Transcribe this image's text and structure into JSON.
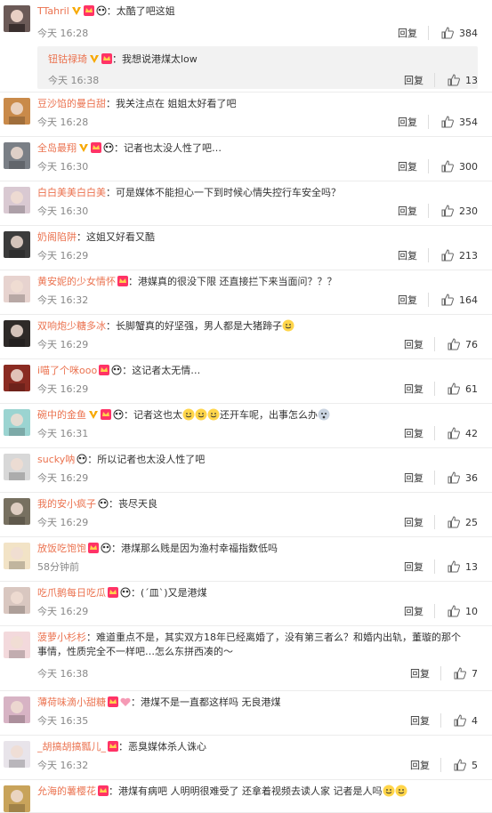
{
  "comments": [
    {
      "user": "TTahril",
      "content": "：太酷了吧这姐",
      "time": "今天 16:28",
      "reply": "回复",
      "likes": "384",
      "sub": {
        "user": "钮钴禄琦",
        "content": "：我想说港煤太low",
        "time": "今天 16:38",
        "reply": "回复",
        "likes": "13"
      }
    },
    {
      "user": "豆沙馅的曼白甜",
      "content": "：我关注点在 姐姐太好看了吧",
      "time": "今天 16:28",
      "reply": "回复",
      "likes": "354"
    },
    {
      "user": "全岛最翔",
      "content": "：记者也太没人性了吧…",
      "time": "今天 16:30",
      "reply": "回复",
      "likes": "300"
    },
    {
      "user": "白白美美白白美",
      "content": "：可是媒体不能担心一下到时候心情失控行车安全吗？",
      "time": "今天 16:30",
      "reply": "回复",
      "likes": "230"
    },
    {
      "user": "奶阁陷阱",
      "content": "：这姐又好看又酷",
      "time": "今天 16:29",
      "reply": "回复",
      "likes": "213"
    },
    {
      "user": "黄安妮的少女情怀",
      "content": "：港媒真的很没下限 还直接拦下来当面问？？？",
      "time": "今天 16:32",
      "reply": "回复",
      "likes": "164"
    },
    {
      "user": "双响炮少糖多冰",
      "content": "：长脚蟹真的好坚强，男人都是大猪蹄子",
      "time": "今天 16:29",
      "reply": "回复",
      "likes": "76"
    },
    {
      "user": "i喵了个咪ooo",
      "content": "：这记者太无情…",
      "time": "今天 16:29",
      "reply": "回复",
      "likes": "61"
    },
    {
      "user": "碗中的金鱼",
      "content": "：记者这也太",
      "content2": "还开车呢，出事怎么办",
      "time": "今天 16:31",
      "reply": "回复",
      "likes": "42"
    },
    {
      "user": "sucky呐",
      "content": "：所以记者也太没人性了吧",
      "time": "今天 16:29",
      "reply": "回复",
      "likes": "36"
    },
    {
      "user": "我的安小疯子",
      "content": "：丧尽天良",
      "time": "今天 16:29",
      "reply": "回复",
      "likes": "25"
    },
    {
      "user": "放饭吃饱饱",
      "content": "：港煤那么贱是因为渔村幸福指数低吗",
      "time": "58分钟前",
      "reply": "回复",
      "likes": "13"
    },
    {
      "user": "吃爪鹅每日吃瓜",
      "content": "：(´皿`)又是港煤",
      "time": "今天 16:29",
      "reply": "回复",
      "likes": "10"
    },
    {
      "user": "菠萝小杉杉",
      "content": "：难道重点不是，其实双方18年已经离婚了，没有第三者么？和婚内出轨，董璇的那个",
      "content2": "事情，性质完全不一样吧…怎么东拼西凑的～",
      "time": "今天 16:38",
      "reply": "回复",
      "likes": "7"
    },
    {
      "user": "薄荷味滴小甜糖",
      "content": "：港煤不是一直都这样吗  无良港煤",
      "time": "今天 16:35",
      "reply": "回复",
      "likes": "4"
    },
    {
      "user": "_胡搞胡搞瓢儿_",
      "content": "：恶臭媒体杀人诛心",
      "time": "今天 16:32",
      "reply": "回复",
      "likes": "5"
    },
    {
      "user": "允海的薯樱花",
      "content": "：港煤有病吧 人明明很难受了 还拿着视频去读人家 记者是人吗",
      "time": "",
      "reply": "",
      "likes": ""
    }
  ],
  "colors": {
    "username": "#eb7350",
    "time": "#888888",
    "divider": "#ececec",
    "subbg": "#f2f2f2"
  }
}
